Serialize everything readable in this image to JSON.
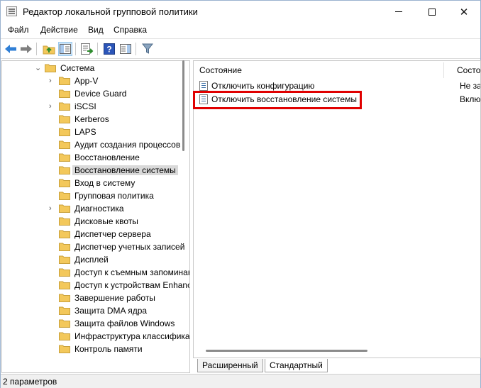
{
  "window": {
    "title": "Редактор локальной групповой политики",
    "minimize_icon": "minimize-icon",
    "maximize_icon": "maximize-icon",
    "close_glyph": "✕"
  },
  "menu": [
    "Файл",
    "Действие",
    "Вид",
    "Справка"
  ],
  "toolbar": [
    "back-arrow-icon",
    "forward-arrow-icon",
    "up-folder-icon",
    "show-hide-tree-icon",
    "export-list-icon",
    "help-icon",
    "properties-pane-icon",
    "filter-icon"
  ],
  "tree": {
    "parent": "Система",
    "items": [
      {
        "label": "App-V",
        "expandable": true
      },
      {
        "label": "Device Guard",
        "expandable": false
      },
      {
        "label": "iSCSI",
        "expandable": true
      },
      {
        "label": "Kerberos",
        "expandable": false
      },
      {
        "label": "LAPS",
        "expandable": false
      },
      {
        "label": "Аудит создания процессов",
        "expandable": false
      },
      {
        "label": "Восстановление",
        "expandable": false
      },
      {
        "label": "Восстановление системы",
        "expandable": false,
        "selected": true
      },
      {
        "label": "Вход в систему",
        "expandable": false
      },
      {
        "label": "Групповая политика",
        "expandable": false
      },
      {
        "label": "Диагностика",
        "expandable": true
      },
      {
        "label": "Дисковые квоты",
        "expandable": false
      },
      {
        "label": "Диспетчер сервера",
        "expandable": false
      },
      {
        "label": "Диспетчер учетных записей",
        "expandable": false
      },
      {
        "label": "Дисплей",
        "expandable": false
      },
      {
        "label": "Доступ к съемным запоминающим устройствам",
        "expandable": false
      },
      {
        "label": "Доступ к устройствам Enhanced Storage",
        "expandable": false
      },
      {
        "label": "Завершение работы",
        "expandable": false
      },
      {
        "label": "Защита DMA ядра",
        "expandable": false
      },
      {
        "label": "Защита файлов Windows",
        "expandable": false
      },
      {
        "label": "Инфраструктура классификации файлов",
        "expandable": false
      },
      {
        "label": "Контроль памяти",
        "expandable": false
      }
    ]
  },
  "list": {
    "columns": [
      "Состояние",
      "Состояние"
    ],
    "rows": [
      {
        "name": "Отключить конфигурацию",
        "state": "Не задана"
      },
      {
        "name": "Отключить восстановление системы",
        "state": "Включена"
      }
    ]
  },
  "tabs": [
    "Расширенный",
    "Стандартный"
  ],
  "status": "2 параметров",
  "colors": {
    "highlight": "#e00000",
    "folder": "#f3c85b",
    "selected_bg": "#d9d9d9"
  }
}
